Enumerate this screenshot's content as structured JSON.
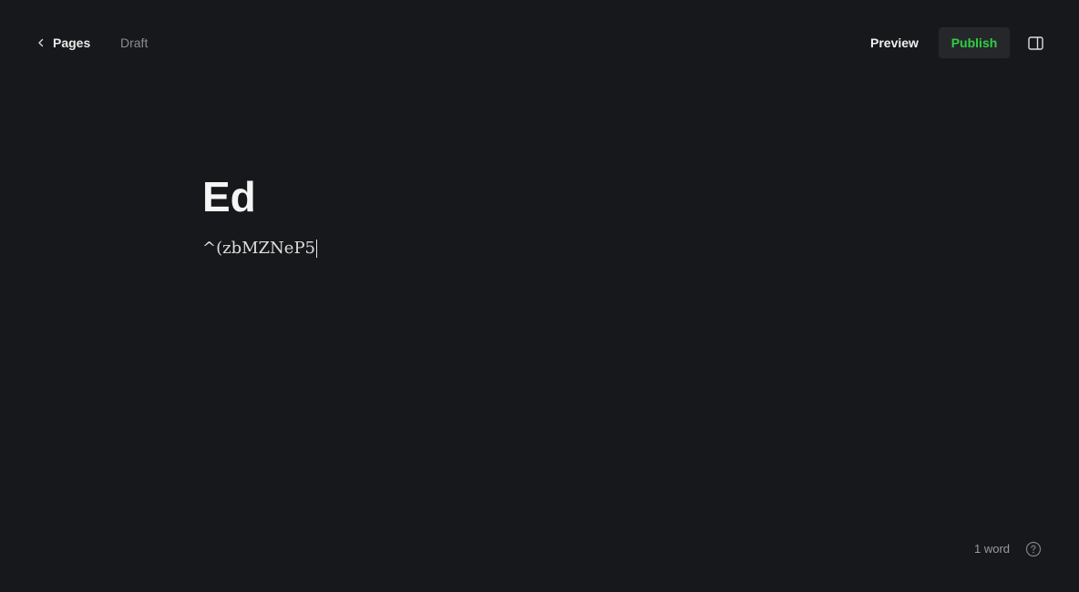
{
  "topbar": {
    "back_label": "Pages",
    "back_icon": "chevron-left-icon",
    "status": "Draft",
    "preview_label": "Preview",
    "publish_label": "Publish",
    "sidebar_icon": "sidebar-panel-icon"
  },
  "editor": {
    "title": "Ed",
    "body": "^(zbMZNeP5"
  },
  "footer": {
    "word_count": "1 word",
    "help_icon": "help-circle-icon"
  },
  "colors": {
    "background": "#17181b",
    "publish_accent": "#30cf43",
    "publish_bg": "#26272b"
  }
}
